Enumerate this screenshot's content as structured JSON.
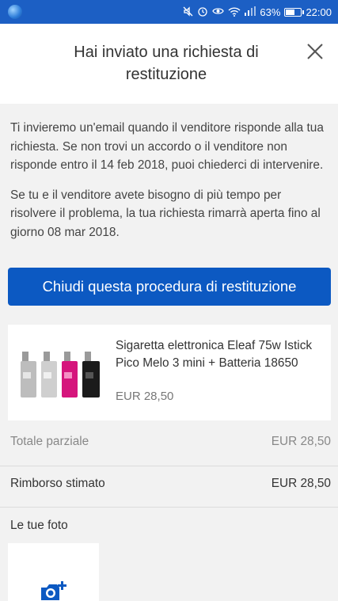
{
  "status_bar": {
    "battery": "63%",
    "battery_level": 0.63,
    "time": "22:00",
    "icons": [
      "app-globe-icon",
      "mute-icon",
      "alarm-icon",
      "eye-icon",
      "wifi-icon",
      "signal-icon",
      "battery-icon"
    ]
  },
  "header": {
    "title": "Hai inviato una richiesta di restituzione",
    "close_icon": "close-icon"
  },
  "info": {
    "paragraph_1": "Ti invieremo un'email quando il venditore risponde alla tua richiesta. Se non trovi un accordo o il venditore non risponde entro il 14 feb 2018, puoi chiederci di intervenire.",
    "paragraph_2": "Se tu e il venditore avete bisogno di più tempo per risolvere il problema, la tua richiesta rimarrà aperta fino al giorno 08 mar 2018."
  },
  "primary_button": {
    "label": "Chiudi questa procedura di restituzione"
  },
  "item": {
    "title": "Sigaretta elettronica Eleaf 75w Istick Pico Melo 3 mini + Batteria 18650",
    "price": "EUR 28,50"
  },
  "summary": {
    "subtotal_label": "Totale parziale",
    "subtotal_value": "EUR 28,50",
    "refund_label": "Rimborso stimato",
    "refund_value": "EUR 28,50"
  },
  "photos": {
    "label": "Le tue foto",
    "add_icon": "add-photo-camera-icon"
  },
  "colors": {
    "accent": "#0c59c2",
    "status_bar": "#1c5fc4",
    "background": "#f2f2f2"
  }
}
